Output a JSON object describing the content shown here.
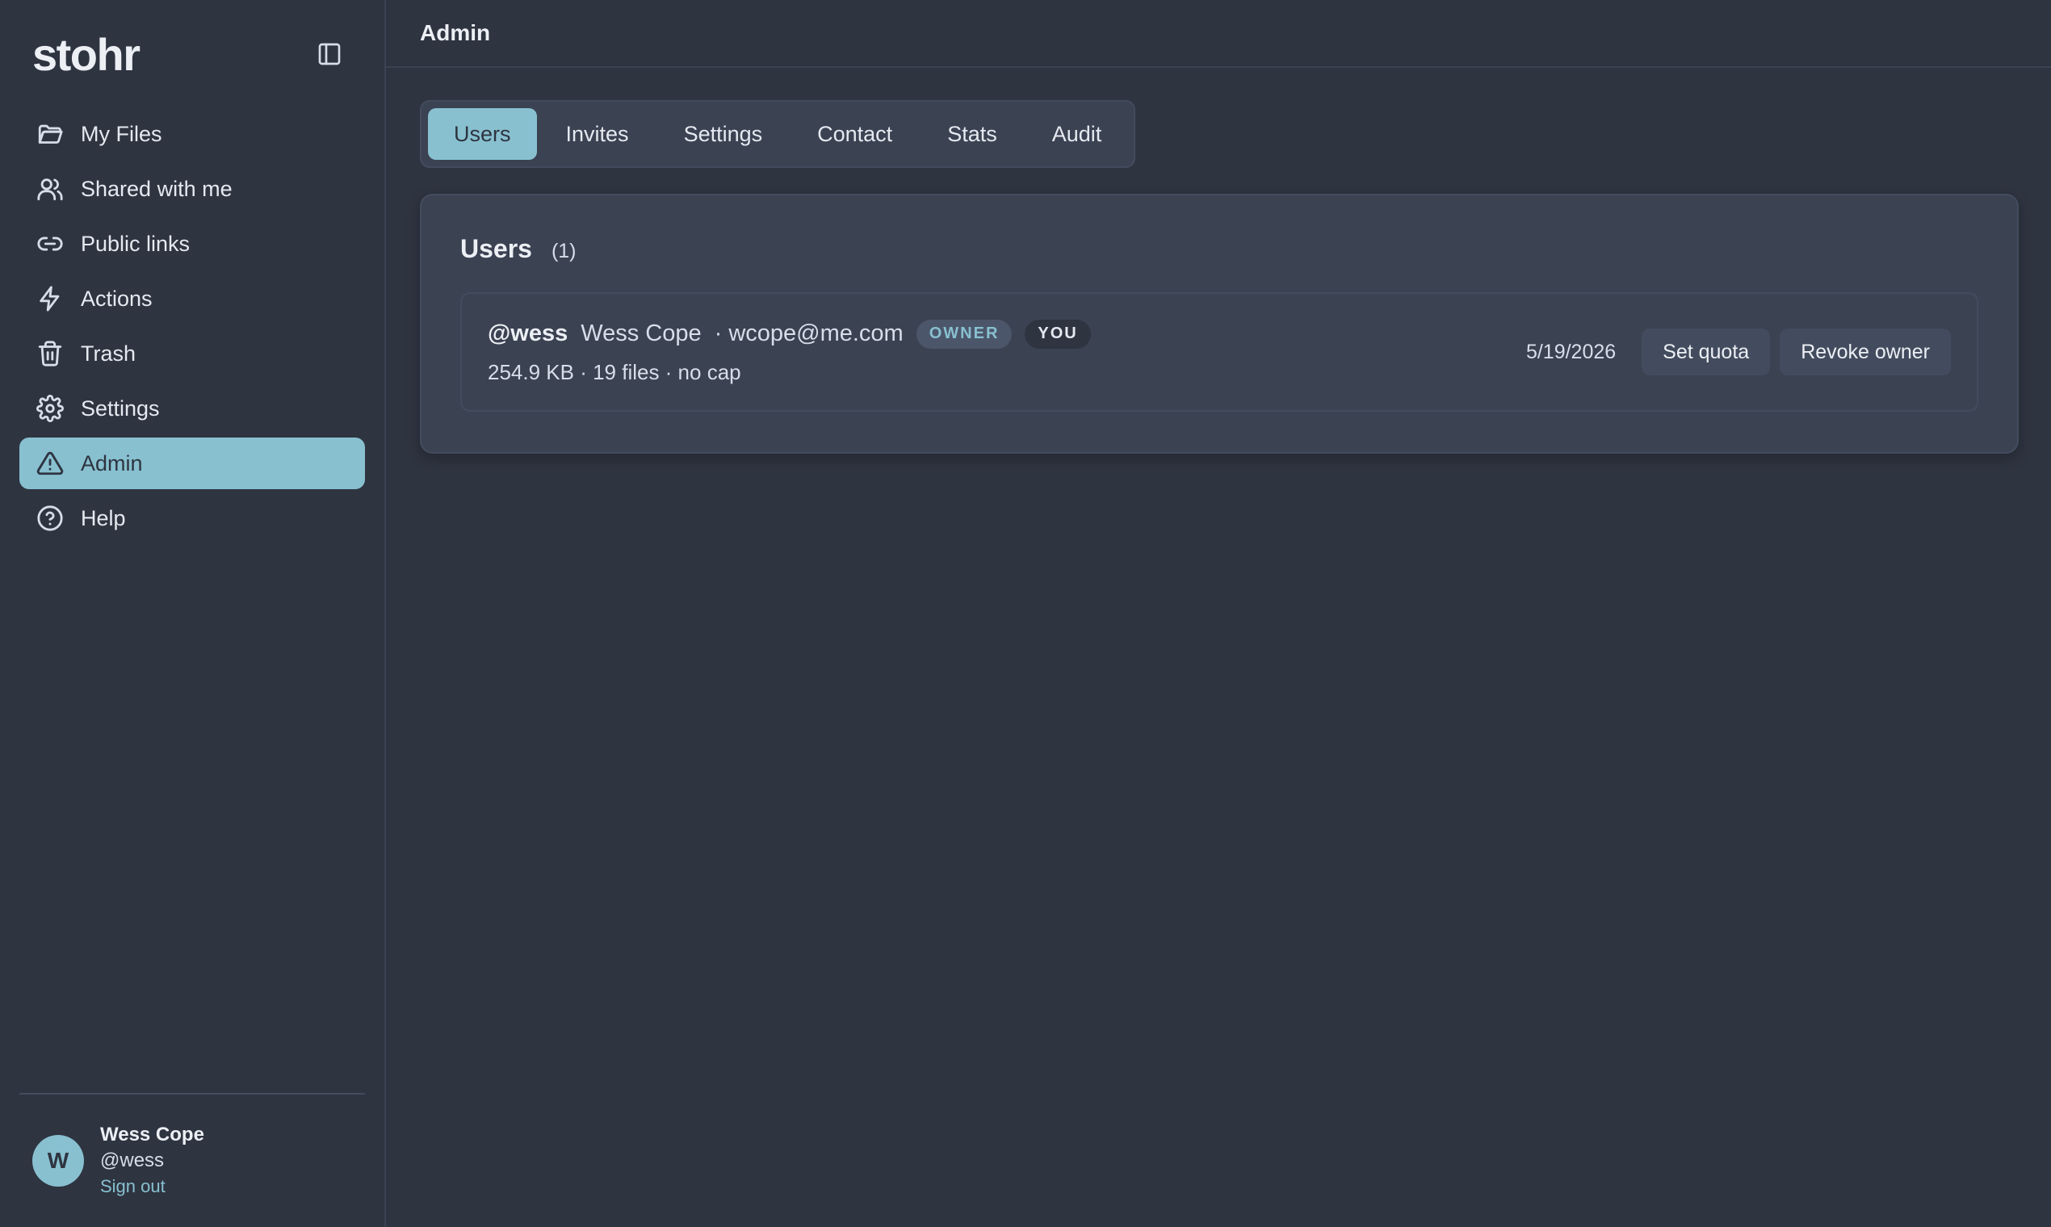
{
  "app": {
    "logo": "stohr"
  },
  "sidebar": {
    "items": [
      {
        "label": "My Files",
        "icon": "folder-icon"
      },
      {
        "label": "Shared with me",
        "icon": "users-icon"
      },
      {
        "label": "Public links",
        "icon": "link-icon"
      },
      {
        "label": "Actions",
        "icon": "lightning-icon"
      },
      {
        "label": "Trash",
        "icon": "trash-icon"
      },
      {
        "label": "Settings",
        "icon": "gear-icon"
      },
      {
        "label": "Admin",
        "icon": "warning-icon",
        "active": true
      },
      {
        "label": "Help",
        "icon": "help-icon"
      }
    ],
    "footer": {
      "avatar_initial": "W",
      "name": "Wess Cope",
      "handle": "@wess",
      "signout_label": "Sign out"
    }
  },
  "header": {
    "title": "Admin"
  },
  "tabs": [
    {
      "label": "Users",
      "active": true
    },
    {
      "label": "Invites"
    },
    {
      "label": "Settings"
    },
    {
      "label": "Contact"
    },
    {
      "label": "Stats"
    },
    {
      "label": "Audit"
    }
  ],
  "users_card": {
    "title": "Users",
    "count": "(1)",
    "rows": [
      {
        "handle": "@wess",
        "name": "Wess Cope",
        "email": "· wcope@me.com",
        "badges": [
          "OWNER",
          "YOU"
        ],
        "stats": "254.9 KB · 19 files · no cap",
        "date": "5/19/2026",
        "actions": [
          "Set quota",
          "Revoke owner"
        ]
      }
    ]
  },
  "colors": {
    "background": "#2e3440",
    "surface": "#3b4252",
    "accent": "#88c0d0"
  }
}
